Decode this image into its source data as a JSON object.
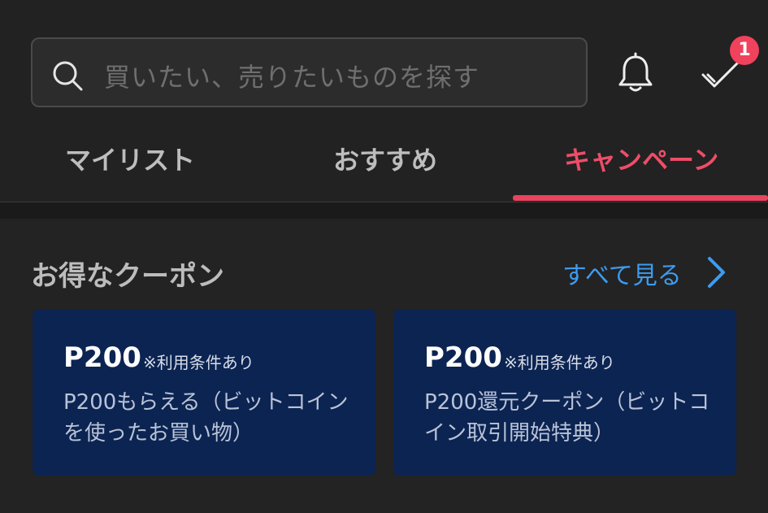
{
  "search": {
    "placeholder": "買いたい、売りたいものを探す"
  },
  "header": {
    "todo_badge": "1"
  },
  "tabs": [
    {
      "label": "マイリスト",
      "active": false
    },
    {
      "label": "おすすめ",
      "active": false
    },
    {
      "label": "キャンペーン",
      "active": true
    }
  ],
  "coupons": {
    "title": "お得なクーポン",
    "see_all": "すべて見る",
    "items": [
      {
        "amount": "P200",
        "condition": "※利用条件あり",
        "description": "P200もらえる（ビットコインを使ったお買い物）"
      },
      {
        "amount": "P200",
        "condition": "※利用条件あり",
        "description": "P200還元クーポン（ビットコイン取引開始特典）"
      }
    ]
  },
  "colors": {
    "accent": "#e9435d",
    "link": "#3d9bf0",
    "card": "#0c2452"
  }
}
